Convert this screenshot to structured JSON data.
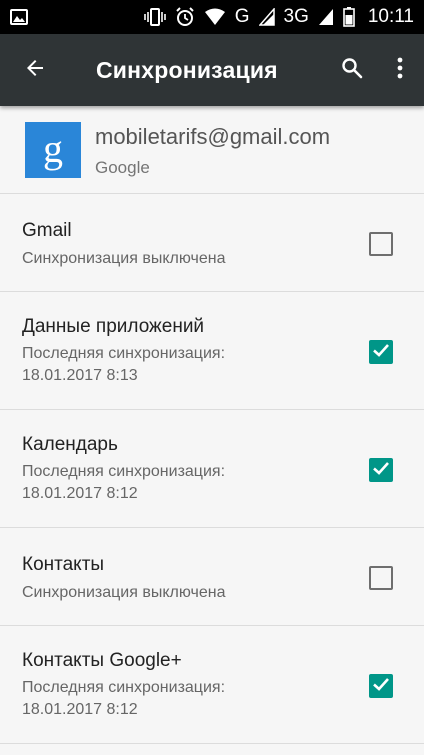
{
  "status_bar": {
    "network_label": "G",
    "network2_label": "3G",
    "time": "10:11",
    "icons": [
      "image-icon",
      "vibrate-icon",
      "alarm-icon",
      "wifi-icon",
      "signal-icon",
      "signal-icon",
      "battery-icon"
    ]
  },
  "app_bar": {
    "title": "Синхронизация",
    "background": "#2f3436"
  },
  "account": {
    "email": "mobiletarifs@gmail.com",
    "type": "Google",
    "logo_letter": "g",
    "logo_color": "#2a86d8"
  },
  "accent_color": "#009688",
  "sync_items": [
    {
      "title": "Gmail",
      "subtitle_line1": "Синхронизация выключена",
      "subtitle_line2": "",
      "checked": false
    },
    {
      "title": "Данные приложений",
      "subtitle_line1": "Последняя синхронизация:",
      "subtitle_line2": "18.01.2017 8:13",
      "checked": true
    },
    {
      "title": "Календарь",
      "subtitle_line1": "Последняя синхронизация:",
      "subtitle_line2": "18.01.2017 8:12",
      "checked": true
    },
    {
      "title": "Контакты",
      "subtitle_line1": "Синхронизация выключена",
      "subtitle_line2": "",
      "checked": false
    },
    {
      "title": "Контакты Google+",
      "subtitle_line1": "Последняя синхронизация:",
      "subtitle_line2": "18.01.2017 8:12",
      "checked": true
    }
  ]
}
